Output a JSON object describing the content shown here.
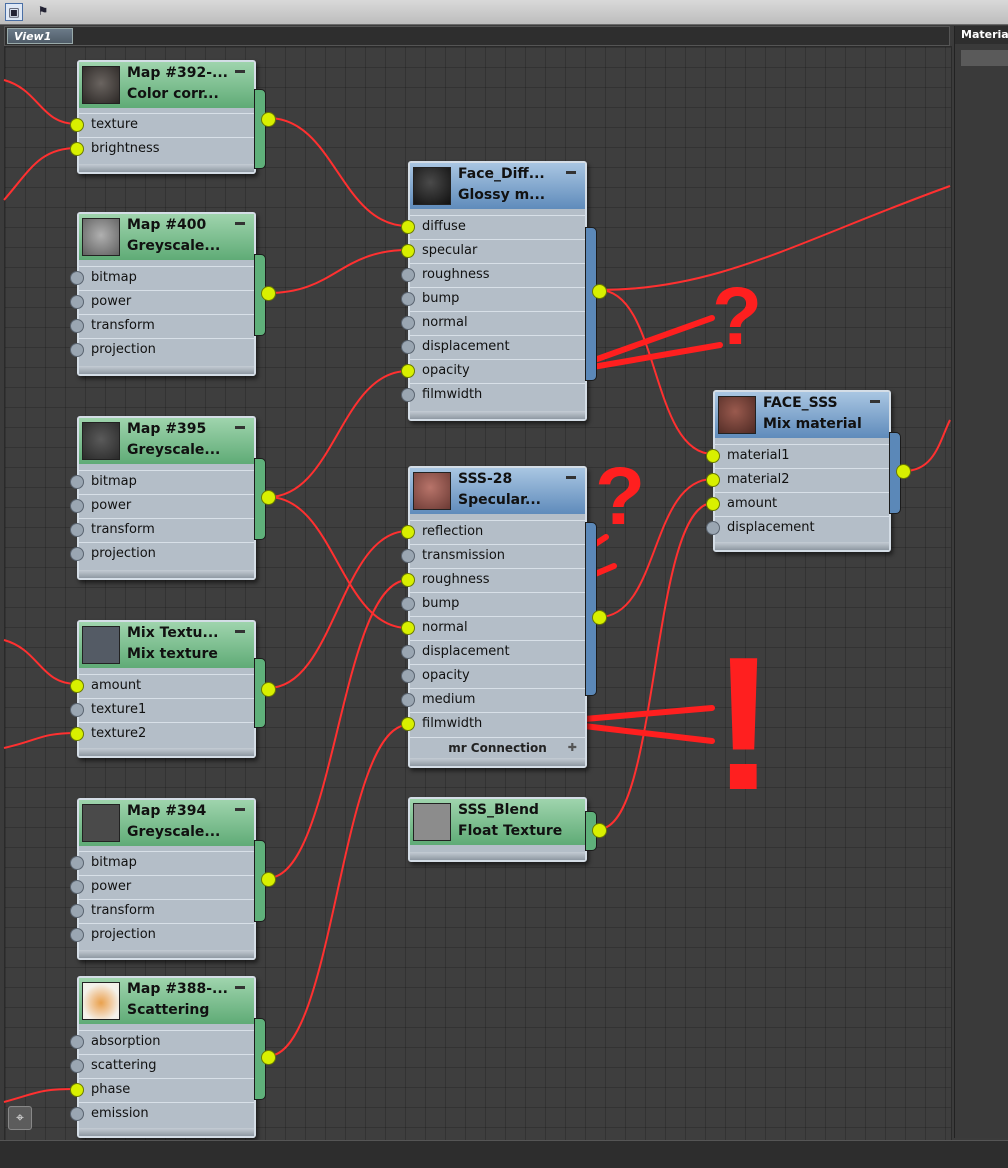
{
  "toolbar": {
    "layout_icon": "window-layout-icon",
    "select_icon": "checkered-flag-icon"
  },
  "tabs": {
    "view1": "View1"
  },
  "right_panel": {
    "title": "Material"
  },
  "nodes": {
    "map392": {
      "line1": "Map #392-...",
      "line2": "Color corr...",
      "ports": [
        "texture",
        "brightness"
      ]
    },
    "map400": {
      "line1": "Map #400",
      "line2": "Greyscale...",
      "ports": [
        "bitmap",
        "power",
        "transform",
        "projection"
      ]
    },
    "map395": {
      "line1": "Map #395",
      "line2": "Greyscale...",
      "ports": [
        "bitmap",
        "power",
        "transform",
        "projection"
      ]
    },
    "mixtex": {
      "line1": "Mix Textu...",
      "line2": "Mix texture",
      "ports": [
        "amount",
        "texture1",
        "texture2"
      ]
    },
    "map394": {
      "line1": "Map #394",
      "line2": "Greyscale...",
      "ports": [
        "bitmap",
        "power",
        "transform",
        "projection"
      ]
    },
    "map388": {
      "line1": "Map #388-...",
      "line2": "Scattering",
      "ports": [
        "absorption",
        "scattering",
        "phase",
        "emission"
      ]
    },
    "facediff": {
      "line1": "Face_Diff...",
      "line2": "Glossy m...",
      "ports": [
        "diffuse",
        "specular",
        "roughness",
        "bump",
        "normal",
        "displacement",
        "opacity",
        "filmwidth"
      ]
    },
    "sss28": {
      "line1": "SSS-28",
      "line2": "Specular...",
      "ports": [
        "reflection",
        "transmission",
        "roughness",
        "bump",
        "normal",
        "displacement",
        "opacity",
        "medium",
        "filmwidth"
      ],
      "footer": "mr Connection"
    },
    "sssblend": {
      "line1": "SSS_Blend",
      "line2": "Float Texture"
    },
    "facesss": {
      "line1": "FACE_SSS",
      "line2": "Mix material",
      "ports": [
        "material1",
        "material2",
        "amount",
        "displacement"
      ]
    }
  },
  "annotations": {
    "q1": "?",
    "q2": "?",
    "excl": "!"
  },
  "colors": {
    "wire": "#ff3030",
    "socket_active": "#d8f000",
    "annotation": "#ff1f1f",
    "map_header": "#6fb884",
    "material_header": "#6b95c2"
  }
}
